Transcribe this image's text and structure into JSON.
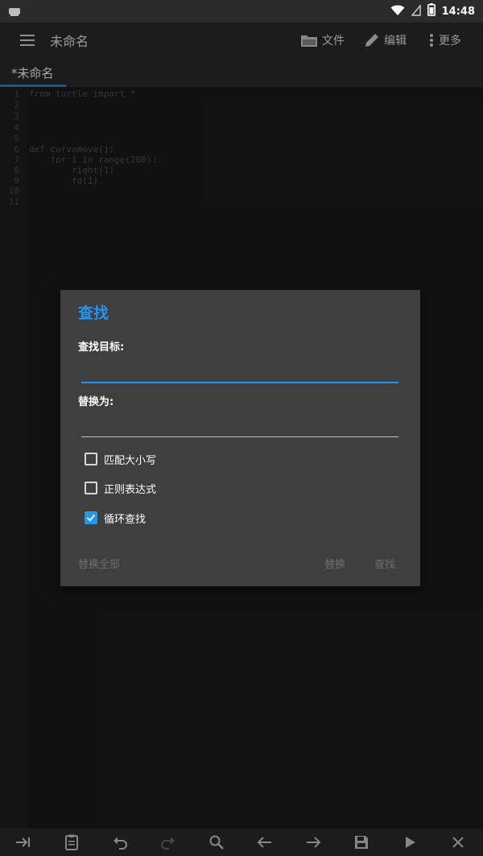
{
  "status_bar": {
    "time": "14:48"
  },
  "app_bar": {
    "title": "未命名",
    "file_label": "文件",
    "edit_label": "编辑",
    "more_label": "更多"
  },
  "tabs": [
    {
      "label": "*未命名"
    }
  ],
  "editor": {
    "lines": [
      {
        "num": "1",
        "text": "from turtle import *"
      },
      {
        "num": "2",
        "text": ""
      },
      {
        "num": "3",
        "text": ""
      },
      {
        "num": "4",
        "text": ""
      },
      {
        "num": "5",
        "text": ""
      },
      {
        "num": "6",
        "text": "def curvemove():"
      },
      {
        "num": "7",
        "text": "    for i in range(200):"
      },
      {
        "num": "8",
        "text": "        right(1)"
      },
      {
        "num": "9",
        "text": "        fd(1)"
      },
      {
        "num": "10",
        "text": ""
      },
      {
        "num": "11",
        "text": ""
      }
    ]
  },
  "dialog": {
    "title": "查找",
    "find_label": "查找目标:",
    "find_value": "",
    "replace_label": "替换为:",
    "replace_value": "",
    "options": [
      {
        "label": "匹配大小写",
        "checked": false
      },
      {
        "label": "正则表达式",
        "checked": false
      },
      {
        "label": "循环查找",
        "checked": true
      }
    ],
    "replace_all_button": "替换全部",
    "replace_button": "替换",
    "find_button": "查找"
  },
  "icons": {
    "menu": "menu-icon",
    "file": "folder-icon",
    "edit": "pencil-icon",
    "more": "more-vertical-icon",
    "tools": [
      "tab-indent-icon",
      "clipboard-icon",
      "undo-icon",
      "redo-icon",
      "search-icon",
      "arrow-left-icon",
      "arrow-right-icon",
      "save-icon",
      "run-icon",
      "close-icon"
    ]
  },
  "colors": {
    "accent": "#2196f3",
    "background": "#1b1b1b",
    "bar": "#2b2b2b",
    "dialog": "#3f3f3f"
  }
}
